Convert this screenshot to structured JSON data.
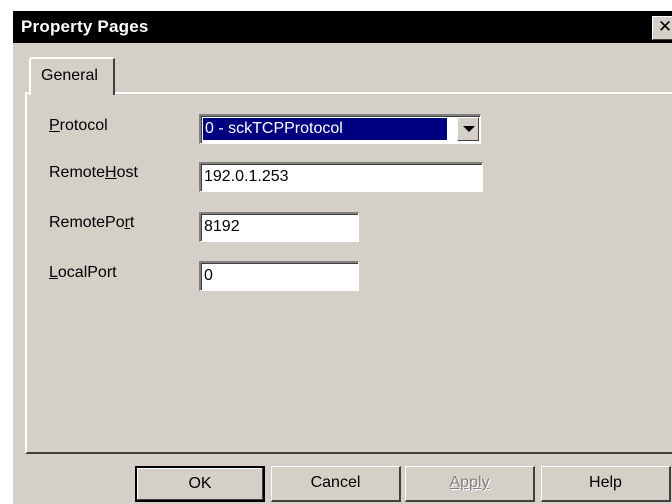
{
  "window": {
    "title": "Property Pages",
    "close_glyph": "✕"
  },
  "tabs": [
    {
      "label": "General",
      "selected": true
    }
  ],
  "fields": {
    "protocol": {
      "label_pre": "",
      "label_key": "P",
      "label_post": "rotocol",
      "value": "0 - sckTCPProtocol"
    },
    "remote_host": {
      "label_pre": "Remote",
      "label_key": "H",
      "label_post": "ost",
      "value": "192.0.1.253"
    },
    "remote_port": {
      "label_pre": "RemotePo",
      "label_key": "r",
      "label_post": "t",
      "value": "8192"
    },
    "local_port": {
      "label_pre": "",
      "label_key": "L",
      "label_post": "ocalPort",
      "value": "0"
    }
  },
  "buttons": {
    "ok": "OK",
    "cancel": "Cancel",
    "apply": "Apply",
    "apply_enabled": false,
    "help": "Help"
  },
  "colors": {
    "face": "#d4d0c8",
    "titlebar": "#000000",
    "selection": "#000080"
  }
}
